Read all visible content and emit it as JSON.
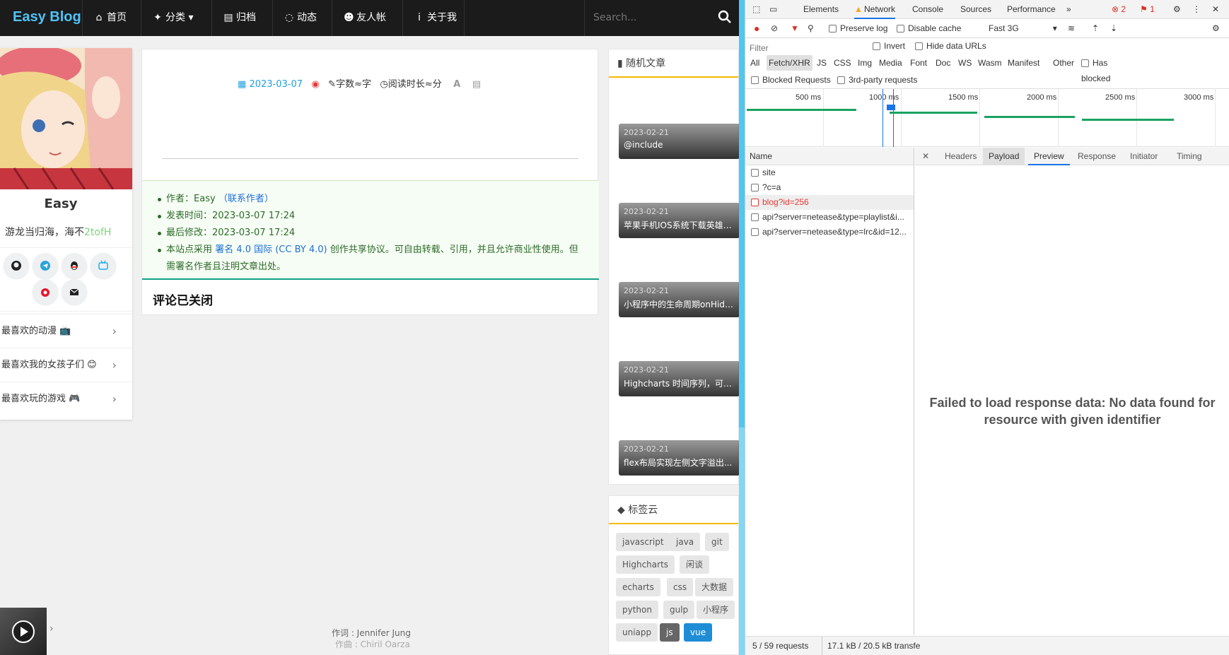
{
  "nav": {
    "brand": "Easy Blog",
    "items": [
      {
        "label": "首页",
        "icon": "home-icon"
      },
      {
        "label": "分类",
        "icon": "lightbulb-icon"
      },
      {
        "label": "归档",
        "icon": "archive-icon"
      },
      {
        "label": "动态",
        "icon": "comment-icon"
      },
      {
        "label": "友人帐",
        "icon": "users-icon"
      },
      {
        "label": "关于我",
        "icon": "info-icon"
      }
    ],
    "search_placeholder": "Search..."
  },
  "profile": {
    "name": "Easy",
    "motto_prefix": "游龙当归海，海不",
    "motto_highlight": "2tofH",
    "favorites": [
      "最喜欢的动漫 📺",
      "最喜欢我的女孩子们 😊",
      "最喜欢玩的游戏 🎮"
    ]
  },
  "article": {
    "date": "2023-03-07",
    "words": "字数≈字",
    "read_time": "阅读时长≈分",
    "license": {
      "author_label": "作者：",
      "author": "Easy",
      "contact": "（联系作者）",
      "published_label": "发表时间：",
      "published": "2023-03-07 17:24",
      "modified_label": "最后修改：",
      "modified": "2023-03-07 17:24",
      "license_prefix": "本站点采用",
      "license_link": "署名 4.0 国际 (CC BY 4.0)",
      "license_suffix": "创作共享协议。可自由转载、引用，并且允许商业性使用。但需署名作者且注明文章出处。"
    },
    "comments_closed": "评论已关闭"
  },
  "random": {
    "title": "随机文章",
    "posts": [
      {
        "date": "2023-02-21",
        "title": "@include"
      },
      {
        "date": "2023-02-21",
        "title": "苹果手机IOS系统下载英雄联盟..."
      },
      {
        "date": "2023-02-21",
        "title": "小程序中的生命周期onHide..."
      },
      {
        "date": "2023-02-21",
        "title": "Highcharts 时间序列，可缩..."
      },
      {
        "date": "2023-02-21",
        "title": "flex布局实现左侧文字溢出..."
      }
    ]
  },
  "tags": {
    "title": "标签云",
    "items": [
      "javascript",
      "java",
      "git",
      "Highcharts",
      "闲谈",
      "echarts",
      "css",
      "大数据",
      "python",
      "gulp",
      "小程序",
      "uniapp",
      "js",
      "vue"
    ]
  },
  "player": {
    "lyric_line1": "作词 : Jennifer Jung",
    "lyric_line2": "作曲 : Chiril Oarza"
  },
  "devtools": {
    "tabs": [
      "Elements",
      "Network",
      "Console",
      "Sources",
      "Performance"
    ],
    "error_count": "2",
    "warn_count": "1",
    "toolbar": {
      "preserve_log": "Preserve log",
      "disable_cache": "Disable cache",
      "throttle": "Fast 3G"
    },
    "filter": {
      "placeholder": "Filter",
      "invert": "Invert",
      "hide_data_urls": "Hide data URLs"
    },
    "types": [
      "All",
      "Fetch/XHR",
      "JS",
      "CSS",
      "Img",
      "Media",
      "Font",
      "Doc",
      "WS",
      "Wasm",
      "Manifest",
      "Other"
    ],
    "has_blocked_cookies": "Has blocked cookies",
    "blocked_requests": "Blocked Requests",
    "third_party": "3rd-party requests",
    "timeline_ticks": [
      "500 ms",
      "1000 ms",
      "1500 ms",
      "2000 ms",
      "2500 ms",
      "3000 ms"
    ],
    "name_header": "Name",
    "requests": [
      "site",
      "?c=a",
      "blog?id=256",
      "api?server=netease&type=playlist&i...",
      "api?server=netease&type=lrc&id=12..."
    ],
    "detail_tabs": [
      "Headers",
      "Payload",
      "Preview",
      "Response",
      "Initiator",
      "Timing"
    ],
    "fail_message": "Failed to load response data: No data found for resource with given identifier",
    "status_requests": "5 / 59 requests",
    "status_transfer": "17.1 kB / 20.5 kB transfe"
  }
}
